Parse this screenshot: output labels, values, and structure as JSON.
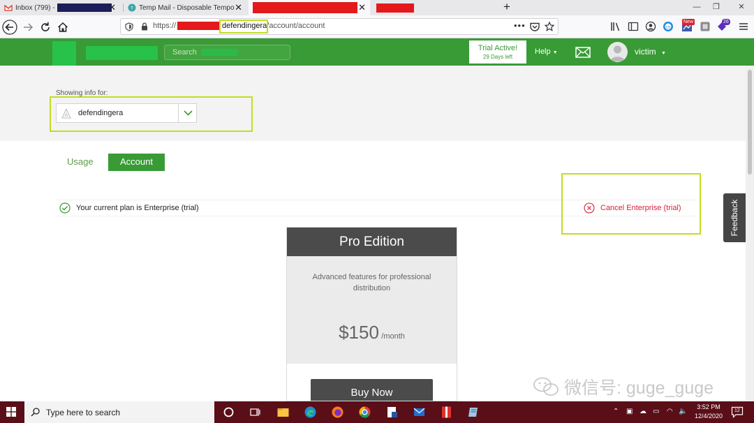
{
  "browser": {
    "tabs": [
      {
        "label": "Inbox (799) -",
        "icon": "gmail-icon",
        "active": false
      },
      {
        "label": "Temp Mail - Disposable Tempo",
        "icon": "temp-mail-icon",
        "active": false
      },
      {
        "label": "",
        "icon": "",
        "active": true
      },
      {
        "label": "",
        "icon": "",
        "active": false
      }
    ],
    "new_tab_label": "+",
    "url_scheme": "https://",
    "url_host": "defendingera",
    "url_path": "/account/account",
    "notification_badge": "26",
    "new_badge": "New"
  },
  "site": {
    "search_placeholder": "Search",
    "trial_title": "Trial Active!",
    "trial_subtitle": "29 Days left",
    "help_label": "Help",
    "username": "victim",
    "brand_color": "#389b35"
  },
  "page": {
    "showing_label": "Showing info for:",
    "org_name": "defendingera",
    "tabs": [
      {
        "label": "Usage",
        "active": false
      },
      {
        "label": "Account",
        "active": true
      }
    ],
    "plan_status": "Your current plan is Enterprise (trial)",
    "cancel_label": "Cancel Enterprise (trial)",
    "feedback_label": "Feedback",
    "card": {
      "title": "Pro Edition",
      "description": "Advanced features for professional distribution",
      "price": "$150",
      "period": "/month",
      "button_label": "Buy Now"
    }
  },
  "watermark": {
    "text": "微信号: guge_guge"
  },
  "taskbar": {
    "search_placeholder": "Type here to search",
    "time": "3:52 PM",
    "date": "12/4/2020",
    "notification_count": "12"
  }
}
